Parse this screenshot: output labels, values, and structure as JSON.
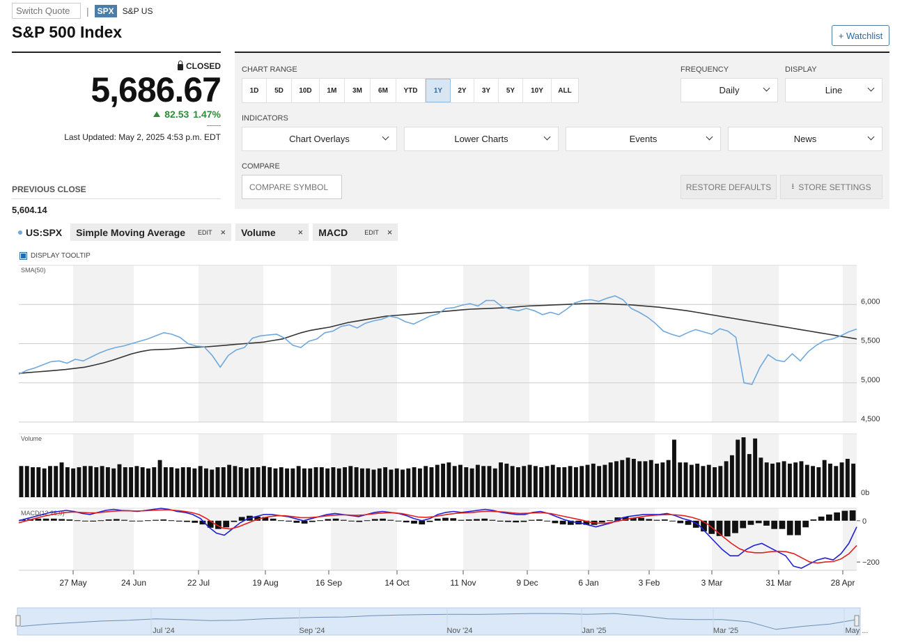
{
  "header": {
    "switch_placeholder": "Switch Quote",
    "symbol_badge": "SPX",
    "exchange": "S&P US",
    "title": "S&P 500 Index",
    "watchlist": "+ Watchlist"
  },
  "quote": {
    "status": "CLOSED",
    "price": "5,686.67",
    "change": "82.53",
    "change_pct": "1.47%",
    "updated": "Last Updated: May 2, 2025 4:53 p.m. EDT",
    "prev_close_label": "PREVIOUS CLOSE",
    "prev_close": "5,604.14"
  },
  "controls": {
    "chart_range_label": "CHART RANGE",
    "ranges": [
      "1D",
      "5D",
      "10D",
      "1M",
      "3M",
      "6M",
      "YTD",
      "1Y",
      "2Y",
      "3Y",
      "5Y",
      "10Y",
      "ALL"
    ],
    "active_range": "1Y",
    "frequency_label": "FREQUENCY",
    "frequency": "Daily",
    "display_label": "DISPLAY",
    "display": "Line",
    "indicators_label": "INDICATORS",
    "indicators": [
      "Chart Overlays",
      "Lower Charts",
      "Events",
      "News"
    ],
    "compare_label": "COMPARE",
    "compare_placeholder": "COMPARE SYMBOL",
    "restore": "RESTORE DEFAULTS",
    "store": "STORE SETTINGS"
  },
  "legend": {
    "symbol": "US:SPX",
    "chips": [
      {
        "name": "Simple Moving Average",
        "edit": "EDIT",
        "close": "×"
      },
      {
        "name": "Volume",
        "edit": "",
        "close": "×"
      },
      {
        "name": "MACD",
        "edit": "EDIT",
        "close": "×"
      }
    ],
    "tooltip": "DISPLAY TOOLTIP"
  },
  "colors": {
    "price_line": "#6fa8dc",
    "sma_line": "#333333",
    "macd_line": "#1f1fd6",
    "signal_line": "#e0201e",
    "bands": "#f2f2f2",
    "accent": "#2d6aa3"
  },
  "chart_data": [
    {
      "type": "line",
      "title": "SMA(50)",
      "y_ticks": [
        "6,000",
        "5,500",
        "5,000",
        "4,500"
      ],
      "ylim": [
        4500,
        6500
      ],
      "x_ticks": [
        "27 May",
        "24 Jun",
        "22 Jul",
        "19 Aug",
        "16 Sep",
        "14 Oct",
        "11 Nov",
        "9 Dec",
        "6 Jan",
        "3 Feb",
        "3 Mar",
        "31 Mar",
        "28 Apr"
      ],
      "series": [
        {
          "role": "price",
          "values": [
            5110,
            5160,
            5190,
            5230,
            5270,
            5280,
            5250,
            5300,
            5280,
            5330,
            5380,
            5420,
            5450,
            5470,
            5500,
            5530,
            5560,
            5600,
            5640,
            5620,
            5580,
            5500,
            5470,
            5460,
            5350,
            5200,
            5350,
            5420,
            5450,
            5570,
            5600,
            5610,
            5620,
            5570,
            5480,
            5450,
            5530,
            5560,
            5640,
            5660,
            5720,
            5740,
            5700,
            5760,
            5790,
            5810,
            5850,
            5830,
            5780,
            5750,
            5800,
            5850,
            5880,
            5950,
            5960,
            5990,
            6010,
            5980,
            6050,
            6050,
            5970,
            5940,
            5920,
            5950,
            5920,
            5870,
            5900,
            5870,
            5940,
            6020,
            6050,
            6060,
            6040,
            6080,
            6110,
            6060,
            5950,
            5900,
            5840,
            5760,
            5660,
            5620,
            5590,
            5640,
            5680,
            5650,
            5620,
            5690,
            5660,
            5580,
            5000,
            4980,
            5200,
            5360,
            5290,
            5270,
            5370,
            5280,
            5400,
            5480,
            5540,
            5560,
            5600,
            5650,
            5687
          ]
        },
        {
          "role": "sma",
          "values": [
            5120,
            5130,
            5140,
            5150,
            5160,
            5170,
            5185,
            5200,
            5225,
            5255,
            5290,
            5330,
            5370,
            5400,
            5420,
            5425,
            5430,
            5440,
            5450,
            5455,
            5460,
            5470,
            5480,
            5490,
            5500,
            5510,
            5520,
            5540,
            5560,
            5600,
            5640,
            5670,
            5690,
            5710,
            5740,
            5770,
            5790,
            5810,
            5830,
            5850,
            5860,
            5870,
            5880,
            5890,
            5900,
            5910,
            5920,
            5930,
            5940,
            5945,
            5950,
            5955,
            5960,
            5970,
            5980,
            5985,
            5990,
            5995,
            6000,
            6005,
            6010,
            6010,
            6010,
            6005,
            6000,
            5995,
            5985,
            5975,
            5965,
            5950,
            5935,
            5920,
            5900,
            5880,
            5860,
            5840,
            5820,
            5800,
            5780,
            5760,
            5740,
            5720,
            5700,
            5680,
            5660,
            5640,
            5620,
            5600,
            5580,
            5560
          ]
        }
      ]
    },
    {
      "type": "bar",
      "title": "Volume",
      "y_ticks": [
        "0b"
      ],
      "values": [
        0.52,
        0.52,
        0.5,
        0.5,
        0.48,
        0.52,
        0.52,
        0.58,
        0.5,
        0.48,
        0.5,
        0.52,
        0.52,
        0.5,
        0.52,
        0.5,
        0.48,
        0.55,
        0.5,
        0.5,
        0.52,
        0.5,
        0.48,
        0.5,
        0.62,
        0.5,
        0.5,
        0.48,
        0.5,
        0.5,
        0.48,
        0.52,
        0.48,
        0.46,
        0.5,
        0.5,
        0.54,
        0.52,
        0.5,
        0.48,
        0.5,
        0.5,
        0.52,
        0.5,
        0.48,
        0.5,
        0.48,
        0.48,
        0.52,
        0.48,
        0.48,
        0.5,
        0.5,
        0.48,
        0.5,
        0.48,
        0.5,
        0.52,
        0.5,
        0.48,
        0.48,
        0.46,
        0.48,
        0.5,
        0.46,
        0.48,
        0.46,
        0.48,
        0.5,
        0.48,
        0.52,
        0.5,
        0.54,
        0.56,
        0.58,
        0.52,
        0.54,
        0.5,
        0.48,
        0.54,
        0.52,
        0.52,
        0.48,
        0.58,
        0.56,
        0.52,
        0.5,
        0.52,
        0.54,
        0.52,
        0.5,
        0.52,
        0.54,
        0.5,
        0.5,
        0.52,
        0.5,
        0.52,
        0.54,
        0.56,
        0.52,
        0.54,
        0.58,
        0.6,
        0.62,
        0.66,
        0.64,
        0.6,
        0.6,
        0.62,
        0.56,
        0.58,
        0.62,
        0.96,
        0.58,
        0.58,
        0.54,
        0.56,
        0.52,
        0.54,
        0.5,
        0.52,
        0.6,
        0.7,
        0.96,
        1.0,
        0.72,
        0.98,
        0.66,
        0.58,
        0.56,
        0.58,
        0.6,
        0.56,
        0.58,
        0.6,
        0.54,
        0.52,
        0.5,
        0.62,
        0.56,
        0.52,
        0.58,
        0.64,
        0.56
      ]
    },
    {
      "type": "line",
      "title": "MACD(12,26,9)",
      "y_ticks": [
        "0",
        "-200"
      ],
      "ylim": [
        -240,
        60
      ],
      "series": [
        {
          "role": "macd",
          "values": [
            0,
            10,
            20,
            30,
            40,
            45,
            50,
            45,
            35,
            30,
            40,
            50,
            55,
            50,
            48,
            45,
            50,
            55,
            60,
            55,
            45,
            40,
            30,
            10,
            -30,
            -60,
            -70,
            -40,
            -10,
            10,
            20,
            30,
            30,
            25,
            20,
            10,
            0,
            10,
            20,
            30,
            35,
            30,
            25,
            20,
            30,
            40,
            45,
            40,
            35,
            25,
            10,
            0,
            10,
            30,
            40,
            45,
            40,
            45,
            50,
            55,
            50,
            40,
            35,
            30,
            30,
            40,
            45,
            35,
            20,
            5,
            -5,
            -10,
            -20,
            -30,
            -20,
            -10,
            10,
            20,
            25,
            30,
            30,
            30,
            35,
            25,
            10,
            0,
            -20,
            -60,
            -100,
            -140,
            -170,
            -170,
            -140,
            -120,
            -110,
            -130,
            -150,
            -170,
            -220,
            -230,
            -210,
            -190,
            -180,
            -190,
            -160,
            -110,
            -30
          ]
        },
        {
          "role": "signal",
          "values": [
            -10,
            0,
            10,
            20,
            28,
            35,
            40,
            42,
            40,
            38,
            38,
            42,
            46,
            48,
            48,
            47,
            48,
            50,
            52,
            53,
            50,
            46,
            40,
            30,
            10,
            -15,
            -35,
            -40,
            -30,
            -15,
            0,
            12,
            20,
            24,
            24,
            20,
            15,
            15,
            18,
            22,
            26,
            28,
            28,
            26,
            28,
            32,
            36,
            38,
            38,
            34,
            26,
            18,
            16,
            20,
            26,
            32,
            36,
            38,
            40,
            44,
            46,
            44,
            42,
            38,
            35,
            36,
            38,
            38,
            34,
            26,
            18,
            10,
            2,
            -8,
            -12,
            -12,
            -6,
            2,
            10,
            16,
            22,
            26,
            28,
            30,
            28,
            24,
            16,
            4,
            -18,
            -48,
            -80,
            -110,
            -135,
            -150,
            -155,
            -155,
            -150,
            -148,
            -150,
            -160,
            -180,
            -200,
            -205,
            -200,
            -198,
            -185,
            -160,
            -120
          ]
        }
      ],
      "histogram": [
        5,
        8,
        10,
        10,
        10,
        8,
        6,
        2,
        -2,
        -4,
        2,
        6,
        8,
        4,
        0,
        -2,
        2,
        4,
        6,
        2,
        -4,
        -6,
        -10,
        -18,
        -34,
        -40,
        -32,
        -6,
        18,
        24,
        20,
        18,
        10,
        2,
        -4,
        -10,
        -14,
        -6,
        2,
        8,
        10,
        4,
        -2,
        -6,
        2,
        8,
        10,
        4,
        -2,
        -8,
        -14,
        -18,
        -6,
        10,
        14,
        12,
        4,
        6,
        8,
        10,
        4,
        -4,
        -6,
        -8,
        -6,
        4,
        6,
        -2,
        -12,
        -18,
        -20,
        -18,
        -20,
        -20,
        -8,
        2,
        16,
        18,
        14,
        14,
        8,
        4,
        6,
        -2,
        -12,
        -20,
        -34,
        -52,
        -64,
        -74,
        -76,
        -60,
        -36,
        -20,
        -12,
        -24,
        -40,
        -40,
        -70,
        -70,
        -32,
        6,
        20,
        30,
        40,
        48,
        50
      ]
    }
  ],
  "navigator": {
    "labels": [
      "Jul '24",
      "Sep '24",
      "Nov '24",
      "Jan '25",
      "Mar '25",
      "May ..."
    ],
    "values": [
      5200,
      5350,
      5450,
      5550,
      5600,
      5700,
      5650,
      5580,
      5600,
      5700,
      5750,
      5800,
      5820,
      5900,
      5950,
      5980,
      6000,
      5990,
      6020,
      6050,
      6040,
      6000,
      6050,
      5900,
      5700,
      5650,
      5650,
      5500,
      5000,
      5200,
      5350,
      5650
    ]
  }
}
